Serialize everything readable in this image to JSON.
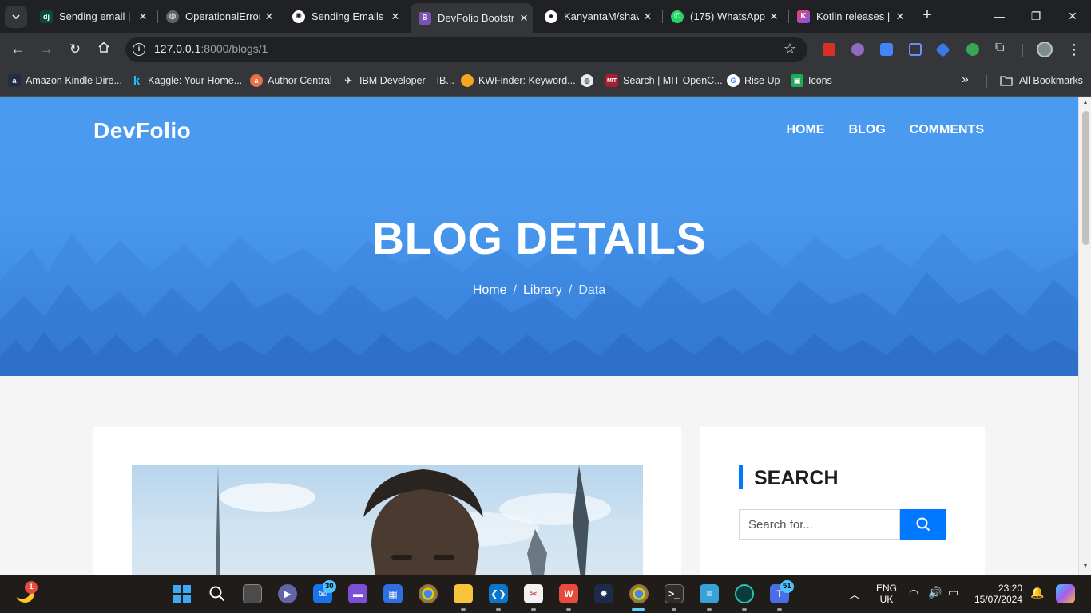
{
  "browser": {
    "tabs": [
      {
        "title": "Sending email | D",
        "favicon": "django-icon",
        "color": "#0c4b33"
      },
      {
        "title": "OperationalError",
        "favicon": "globe-icon",
        "color": "#5f6368"
      },
      {
        "title": "Sending Emails w",
        "favicon": "openai-icon",
        "color": "#ffffff"
      },
      {
        "title": "DevFolio Bootstr",
        "favicon": "bootstrap-icon",
        "color": "#7952b3"
      },
      {
        "title": "KanyantaM/shav",
        "favicon": "github-icon",
        "color": "#ffffff"
      },
      {
        "title": "(175) WhatsApp",
        "favicon": "whatsapp-icon",
        "color": "#25d366"
      },
      {
        "title": "Kotlin releases | K",
        "favicon": "kotlin-icon",
        "color": "#7f52ff"
      }
    ],
    "url_host": "127.0.0.1",
    "url_path": ":8000/blogs/1",
    "bookmarks": [
      {
        "label": "Amazon Kindle Dire...",
        "icon": "amazon-icon",
        "color": "#232f3e"
      },
      {
        "label": "Kaggle: Your Home...",
        "icon": "kaggle-icon",
        "color": "#20beff"
      },
      {
        "label": "Author Central",
        "icon": "author-central-icon",
        "color": "#e8704a"
      },
      {
        "label": "IBM Developer – IB...",
        "icon": "ibm-icon",
        "color": "#1d1d1d"
      },
      {
        "label": "KWFinder: Keyword...",
        "icon": "kwfinder-icon",
        "color": "#f5a623"
      },
      {
        "label": "",
        "icon": "globe-icon",
        "color": "#5f6368"
      },
      {
        "label": "Search | MIT OpenC...",
        "icon": "mit-icon",
        "color": "#a31f34"
      },
      {
        "label": "Rise Up",
        "icon": "google-icon",
        "color": "#ffffff"
      },
      {
        "label": "Icons",
        "icon": "icons-icon",
        "color": "#1faa59"
      }
    ],
    "all_bookmarks": "All Bookmarks"
  },
  "site": {
    "brand": "DevFolio",
    "nav": [
      "HOME",
      "BLOG",
      "COMMENTS"
    ],
    "hero_title": "BLOG DETAILS",
    "breadcrumb": {
      "home": "Home",
      "library": "Library",
      "current": "Data"
    },
    "sidebar": {
      "search_title": "SEARCH",
      "search_placeholder": "Search for..."
    },
    "accent": "#0078ff"
  },
  "taskbar": {
    "mail_badge": "30",
    "teams_badge": "51",
    "notif_badge": "1",
    "lang_top": "ENG",
    "lang_bottom": "UK",
    "time": "23:20",
    "date": "15/07/2024"
  }
}
